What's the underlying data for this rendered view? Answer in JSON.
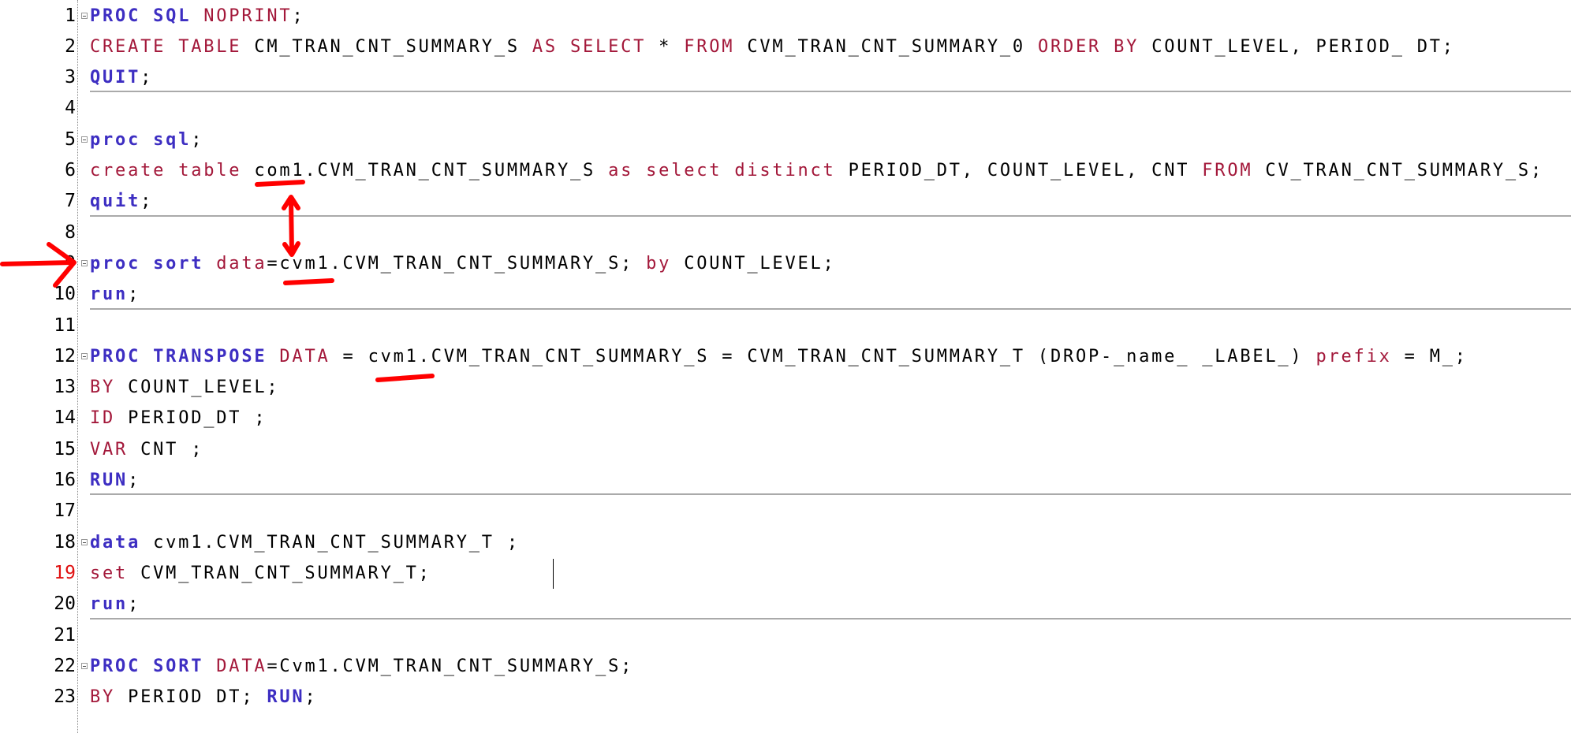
{
  "colors": {
    "keyword": "#3d2ec2",
    "keyword2": "#a3183a",
    "text": "#000000",
    "annotation": "#ff0000"
  },
  "lines": [
    {
      "num": "1",
      "fold": true,
      "sep": false,
      "tokens": [
        [
          "k",
          "PROC"
        ],
        [
          "n",
          " "
        ],
        [
          "k",
          "SQL"
        ],
        [
          "n",
          " "
        ],
        [
          "r",
          "NOPRINT"
        ],
        [
          "n",
          ";"
        ]
      ]
    },
    {
      "num": "2",
      "tokens": [
        [
          "r",
          "CREATE"
        ],
        [
          "n",
          " "
        ],
        [
          "r",
          "TABLE"
        ],
        [
          "n",
          " CM_TRAN_CNT_SUMMARY_S "
        ],
        [
          "r",
          "AS"
        ],
        [
          "n",
          " "
        ],
        [
          "r",
          "SELECT"
        ],
        [
          "n",
          " * "
        ],
        [
          "r",
          "FROM"
        ],
        [
          "n",
          " CVM_TRAN_CNT_SUMMARY_0 "
        ],
        [
          "r",
          "ORDER"
        ],
        [
          "n",
          " "
        ],
        [
          "r",
          "BY"
        ],
        [
          "n",
          " COUNT_LEVEL, PERIOD_ DT;"
        ]
      ]
    },
    {
      "num": "3",
      "sep": true,
      "tokens": [
        [
          "k",
          "QUIT"
        ],
        [
          "n",
          ";"
        ]
      ]
    },
    {
      "num": "4",
      "tokens": []
    },
    {
      "num": "5",
      "fold": true,
      "tokens": [
        [
          "k",
          "proc"
        ],
        [
          "n",
          " "
        ],
        [
          "k",
          "sql"
        ],
        [
          "n",
          ";"
        ]
      ]
    },
    {
      "num": "6",
      "tokens": [
        [
          "r",
          "create"
        ],
        [
          "n",
          " "
        ],
        [
          "r",
          "table"
        ],
        [
          "n",
          " com1.CVM_TRAN_CNT_SUMMARY_S "
        ],
        [
          "r",
          "as"
        ],
        [
          "n",
          " "
        ],
        [
          "r",
          "select"
        ],
        [
          "n",
          " "
        ],
        [
          "r",
          "distinct"
        ],
        [
          "n",
          " PERIOD_DT, COUNT_LEVEL, CNT "
        ],
        [
          "r",
          "FROM"
        ],
        [
          "n",
          " CV_TRAN_CNT_SUMMARY_S;"
        ]
      ]
    },
    {
      "num": "7",
      "sep": true,
      "tokens": [
        [
          "k",
          "quit"
        ],
        [
          "n",
          ";"
        ]
      ]
    },
    {
      "num": "8",
      "tokens": []
    },
    {
      "num": "9",
      "fold": true,
      "tokens": [
        [
          "k",
          "proc"
        ],
        [
          "n",
          " "
        ],
        [
          "k",
          "sort"
        ],
        [
          "n",
          " "
        ],
        [
          "r",
          "data"
        ],
        [
          "n",
          "=cvm1.CVM_TRAN_CNT_SUMMARY_S; "
        ],
        [
          "r",
          "by"
        ],
        [
          "n",
          " COUNT_LEVEL;"
        ]
      ]
    },
    {
      "num": "10",
      "sep": true,
      "tokens": [
        [
          "k",
          "run"
        ],
        [
          "n",
          ";"
        ]
      ]
    },
    {
      "num": "11",
      "tokens": []
    },
    {
      "num": "12",
      "fold": true,
      "tokens": [
        [
          "k",
          "PROC"
        ],
        [
          "n",
          " "
        ],
        [
          "k",
          "TRANSPOSE"
        ],
        [
          "n",
          " "
        ],
        [
          "r",
          "DATA"
        ],
        [
          "n",
          " = cvm1.CVM_TRAN_CNT_SUMMARY_S = CVM_TRAN_CNT_SUMMARY_T (DROP-_name_ _LABEL_) "
        ],
        [
          "r",
          "prefix"
        ],
        [
          "n",
          " = M_;"
        ]
      ]
    },
    {
      "num": "13",
      "tokens": [
        [
          "r",
          "BY"
        ],
        [
          "n",
          " COUNT_LEVEL;"
        ]
      ]
    },
    {
      "num": "14",
      "tokens": [
        [
          "r",
          "ID"
        ],
        [
          "n",
          " PERIOD_DT ;"
        ]
      ]
    },
    {
      "num": "15",
      "tokens": [
        [
          "r",
          "VAR"
        ],
        [
          "n",
          " CNT ;"
        ]
      ]
    },
    {
      "num": "16",
      "sep": true,
      "tokens": [
        [
          "k",
          "RUN"
        ],
        [
          "n",
          ";"
        ]
      ]
    },
    {
      "num": "17",
      "tokens": []
    },
    {
      "num": "18",
      "fold": true,
      "tokens": [
        [
          "k",
          "data"
        ],
        [
          "n",
          " cvm1.CVM_TRAN_CNT_SUMMARY_T ;"
        ]
      ]
    },
    {
      "num": "19",
      "current": true,
      "tokens": [
        [
          "r",
          "set"
        ],
        [
          "n",
          " CVM_TRAN_CNT_SUMMARY_T;"
        ]
      ]
    },
    {
      "num": "20",
      "sep": true,
      "tokens": [
        [
          "k",
          "run"
        ],
        [
          "n",
          ";"
        ]
      ]
    },
    {
      "num": "21",
      "tokens": []
    },
    {
      "num": "22",
      "fold": true,
      "tokens": [
        [
          "k",
          "PROC"
        ],
        [
          "n",
          " "
        ],
        [
          "k",
          "SORT"
        ],
        [
          "n",
          " "
        ],
        [
          "r",
          "DATA"
        ],
        [
          "n",
          "=Cvm1.CVM_TRAN_CNT_SUMMARY_S;"
        ]
      ]
    },
    {
      "num": "23",
      "tokens": [
        [
          "r",
          "BY"
        ],
        [
          "n",
          " PERIOD DT; "
        ],
        [
          "k",
          "RUN"
        ],
        [
          "n",
          ";"
        ]
      ]
    }
  ]
}
